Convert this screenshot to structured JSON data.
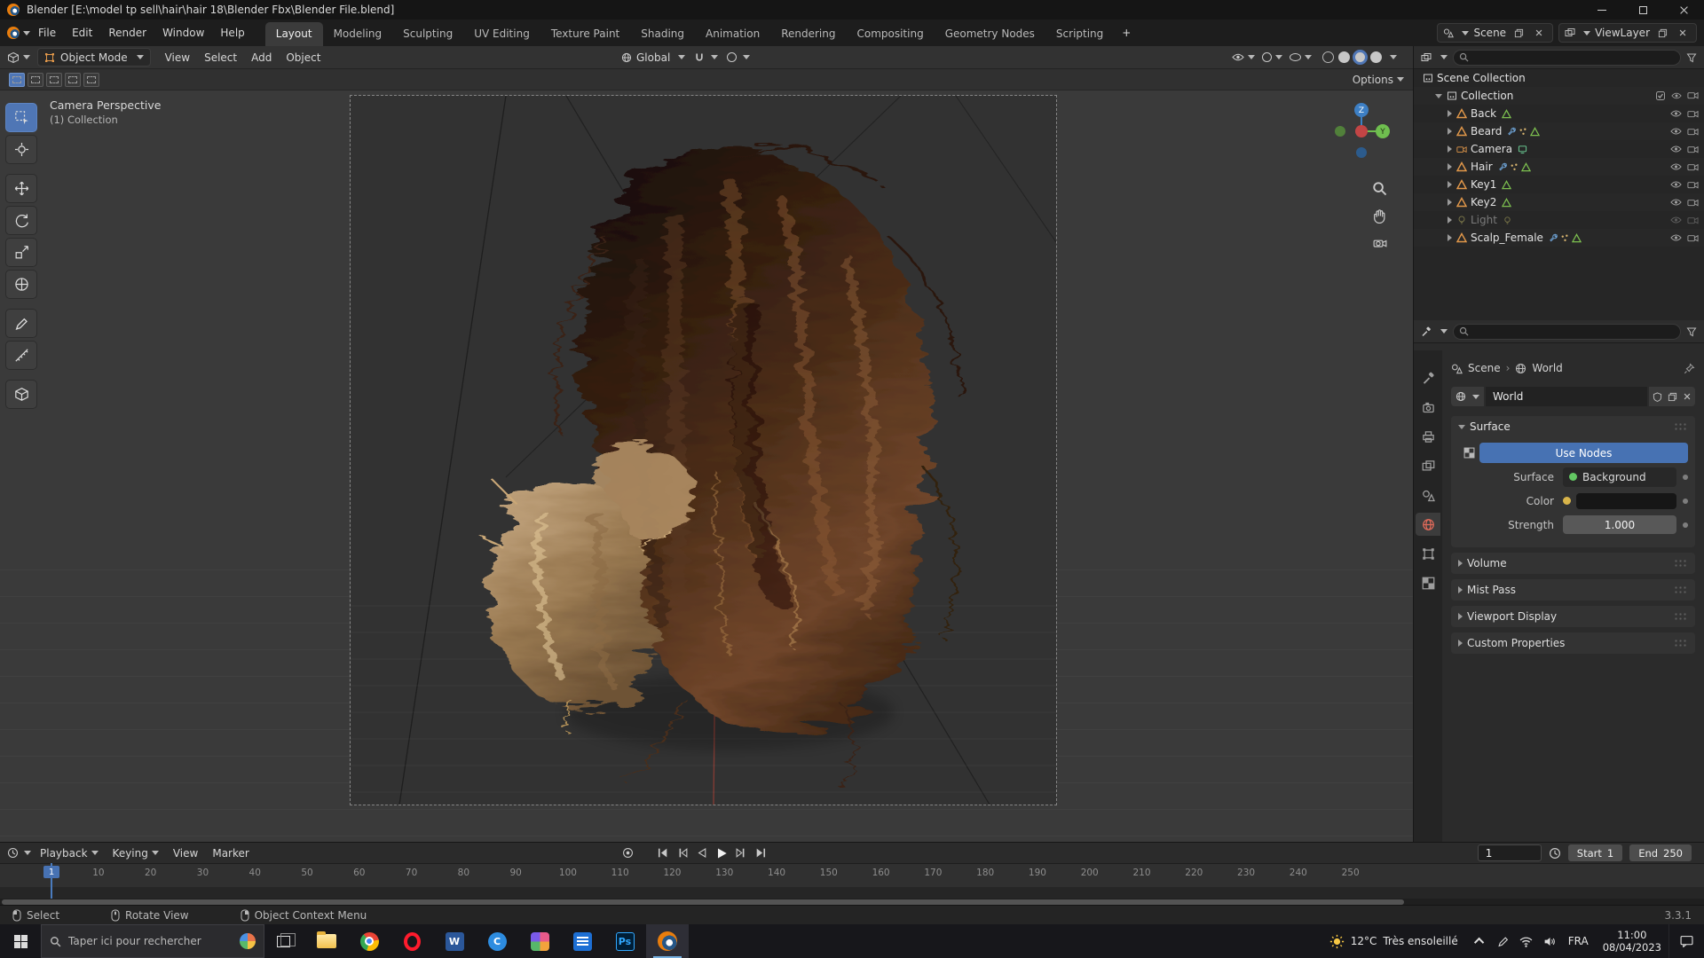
{
  "titlebar": {
    "title": "Blender [E:\\model tp sell\\hair\\hair 18\\Blender Fbx\\Blender File.blend]"
  },
  "topbar": {
    "menus": [
      "File",
      "Edit",
      "Render",
      "Window",
      "Help"
    ],
    "workspaces": [
      "Layout",
      "Modeling",
      "Sculpting",
      "UV Editing",
      "Texture Paint",
      "Shading",
      "Animation",
      "Rendering",
      "Compositing",
      "Geometry Nodes",
      "Scripting"
    ],
    "active_workspace": "Layout",
    "add_workspace": "+",
    "scene_label": "Scene",
    "viewlayer_label": "ViewLayer"
  },
  "header": {
    "mode": "Object Mode",
    "menus": [
      "View",
      "Select",
      "Add",
      "Object"
    ],
    "orientation": "Global",
    "options_label": "Options"
  },
  "viewport": {
    "overlay_line1": "Camera Perspective",
    "overlay_line2": "(1) Collection",
    "gizmo_z": "Z",
    "gizmo_y": "Y"
  },
  "outliner": {
    "root": "Scene Collection",
    "collection": "Collection",
    "items": [
      {
        "name": "Back",
        "type": "mesh",
        "badges": [
          "mesh-data"
        ]
      },
      {
        "name": "Beard",
        "type": "mesh",
        "badges": [
          "modifier",
          "particles",
          "mesh-data"
        ]
      },
      {
        "name": "Camera",
        "type": "camera",
        "badges": [
          "camera-data"
        ]
      },
      {
        "name": "Hair",
        "type": "mesh",
        "badges": [
          "modifier",
          "particles",
          "mesh-data"
        ]
      },
      {
        "name": "Key1",
        "type": "mesh",
        "badges": [
          "mesh-data"
        ]
      },
      {
        "name": "Key2",
        "type": "mesh",
        "badges": [
          "mesh-data"
        ]
      },
      {
        "name": "Light",
        "type": "light",
        "dim": true,
        "badges": [
          "light-data"
        ]
      },
      {
        "name": "Scalp_Female",
        "type": "mesh",
        "badges": [
          "modifier",
          "particles",
          "mesh-data"
        ]
      }
    ]
  },
  "properties": {
    "breadcrumb_scene": "Scene",
    "breadcrumb_sep": "›",
    "breadcrumb_world": "World",
    "datablock": "World",
    "tabs": [
      {
        "id": "tool",
        "icon": "tool"
      },
      {
        "id": "render",
        "icon": "camback"
      },
      {
        "id": "output",
        "icon": "printer"
      },
      {
        "id": "view-layer",
        "icon": "photos"
      },
      {
        "id": "scene",
        "icon": "scene"
      },
      {
        "id": "world",
        "icon": "globe",
        "active": true
      },
      {
        "id": "object",
        "icon": "objsq"
      },
      {
        "id": "texture",
        "icon": "checker"
      }
    ],
    "surface_panel": "Surface",
    "use_nodes": "Use Nodes",
    "surface_label": "Surface",
    "surface_value": "Background",
    "color_label": "Color",
    "strength_label": "Strength",
    "strength_value": "1.000",
    "collapsed_panels": [
      "Volume",
      "Mist Pass",
      "Viewport Display",
      "Custom Properties"
    ]
  },
  "timeline": {
    "menus": [
      "Playback",
      "Keying",
      "View",
      "Marker"
    ],
    "current_frame": "1",
    "start_label": "Start",
    "start_value": "1",
    "end_label": "End",
    "end_value": "250",
    "ticks": [
      "10",
      "20",
      "30",
      "40",
      "50",
      "60",
      "70",
      "80",
      "90",
      "100",
      "110",
      "120",
      "130",
      "140",
      "150",
      "160",
      "170",
      "180",
      "190",
      "200",
      "210",
      "220",
      "230",
      "240",
      "250"
    ]
  },
  "statusbar": {
    "hints": [
      "Select",
      "Rotate View",
      "Object Context Menu"
    ],
    "version": "3.3.1"
  },
  "taskbar": {
    "search_placeholder": "Taper ici pour rechercher",
    "apps": [
      {
        "id": "file-explorer"
      },
      {
        "id": "chrome"
      },
      {
        "id": "opera"
      },
      {
        "id": "word",
        "glyph": "W"
      },
      {
        "id": "c-app",
        "glyph": "C"
      },
      {
        "id": "media-app"
      },
      {
        "id": "document-app"
      },
      {
        "id": "photoshop",
        "glyph": "Ps"
      },
      {
        "id": "blender",
        "active": true
      }
    ],
    "weather_temp": "12°C",
    "weather_desc": "Très ensoleillé",
    "lang": "FRA",
    "time": "11:00",
    "date": "08/04/2023"
  }
}
